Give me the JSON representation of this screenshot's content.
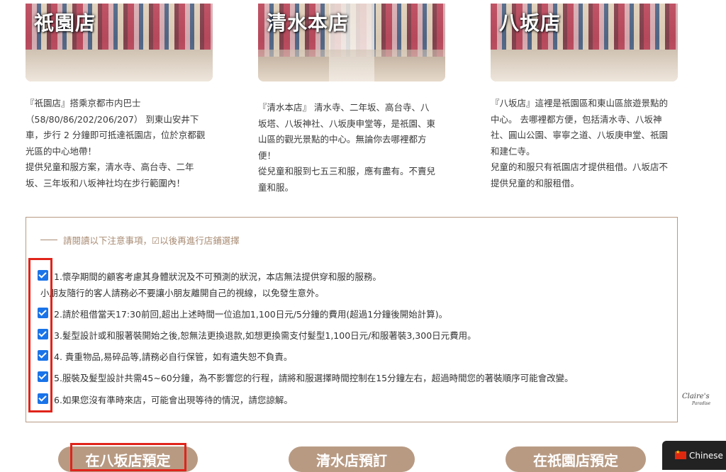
{
  "stores": [
    {
      "name": "祇園店",
      "desc": [
        "『祇園店』搭乘京都市内巴士",
        "（58/80/86/202/206/207） 到東山安井下",
        "車，步行 2 分鐘即可抵達祇園店，位於京都觀",
        "光區的中心地帶！",
        "提供兒童和服方案，清水寺、高台寺、二年",
        "坂、三年坂和八坂神社均在步行範圍內！"
      ]
    },
    {
      "name": "清水本店",
      "desc": [
        "『清水本店』 清水寺、二年坂、高台寺、八",
        "坂塔、八坂神社、八坂庚申堂等，是祇園、東",
        "山區的觀光景點的中心。無論你去哪裡都方",
        "便！",
        "從兒童和服到七五三和服，應有盡有。不賣兒",
        "童和服。"
      ]
    },
    {
      "name": "八坂店",
      "desc": [
        "『八坂店』這裡是祇園區和東山區旅遊景點的",
        "中心。 去哪裡都方便，包括清水寺、八坂神",
        "社、圓山公園、寧寧之道、八坂庚申堂、祇園",
        "和建仁寺。",
        "兒童的和服只有祇園店才提供租借。八坂店不",
        "提供兒童的和服租借。"
      ]
    }
  ],
  "notice": {
    "heading": "請閱讀以下注意事項，☑以後再進行店鋪選擇",
    "items": [
      "1.懷孕期間的顧客考慮其身體狀況及不可預測的狀況，本店無法提供穿和服的服務。",
      "2.請於租借當天17:30前回,超出上述時間一位追加1,100日元/5分鐘的費用(超過1分鐘後開始計算)。",
      "3.髮型設計或和服著裝開始之後,恕無法更換退款,如想更換需支付髮型1,100日元/和服著裝3,300日元費用。",
      "4. 貴重物品,易碎品等,請務必自行保管，如有遺失恕不負責。",
      "5.服裝及髮型設計共需45~60分鐘，為不影響您的行程，請將和服選擇時間控制在15分鐘左右，超過時間您的著裝順序可能會改變。",
      "6.如果您沒有準時來店，可能會出現等待的情況，請您諒解。"
    ],
    "item1_sub": "小朋友隨行的客人請務必不要讓小朋友離開自己的視線，以免發生意外。"
  },
  "brand": {
    "name": "Claire's",
    "sub": "Paradise"
  },
  "buttons": {
    "yasaka": "在八坂店預定",
    "kiyomizu": "清水店預訂",
    "gion": "在祇園店預定"
  },
  "language": {
    "label": "Chinese"
  },
  "colors": {
    "accent": "#b89a83",
    "highlight": "#e0241b",
    "checkbox": "#1a73e8"
  }
}
